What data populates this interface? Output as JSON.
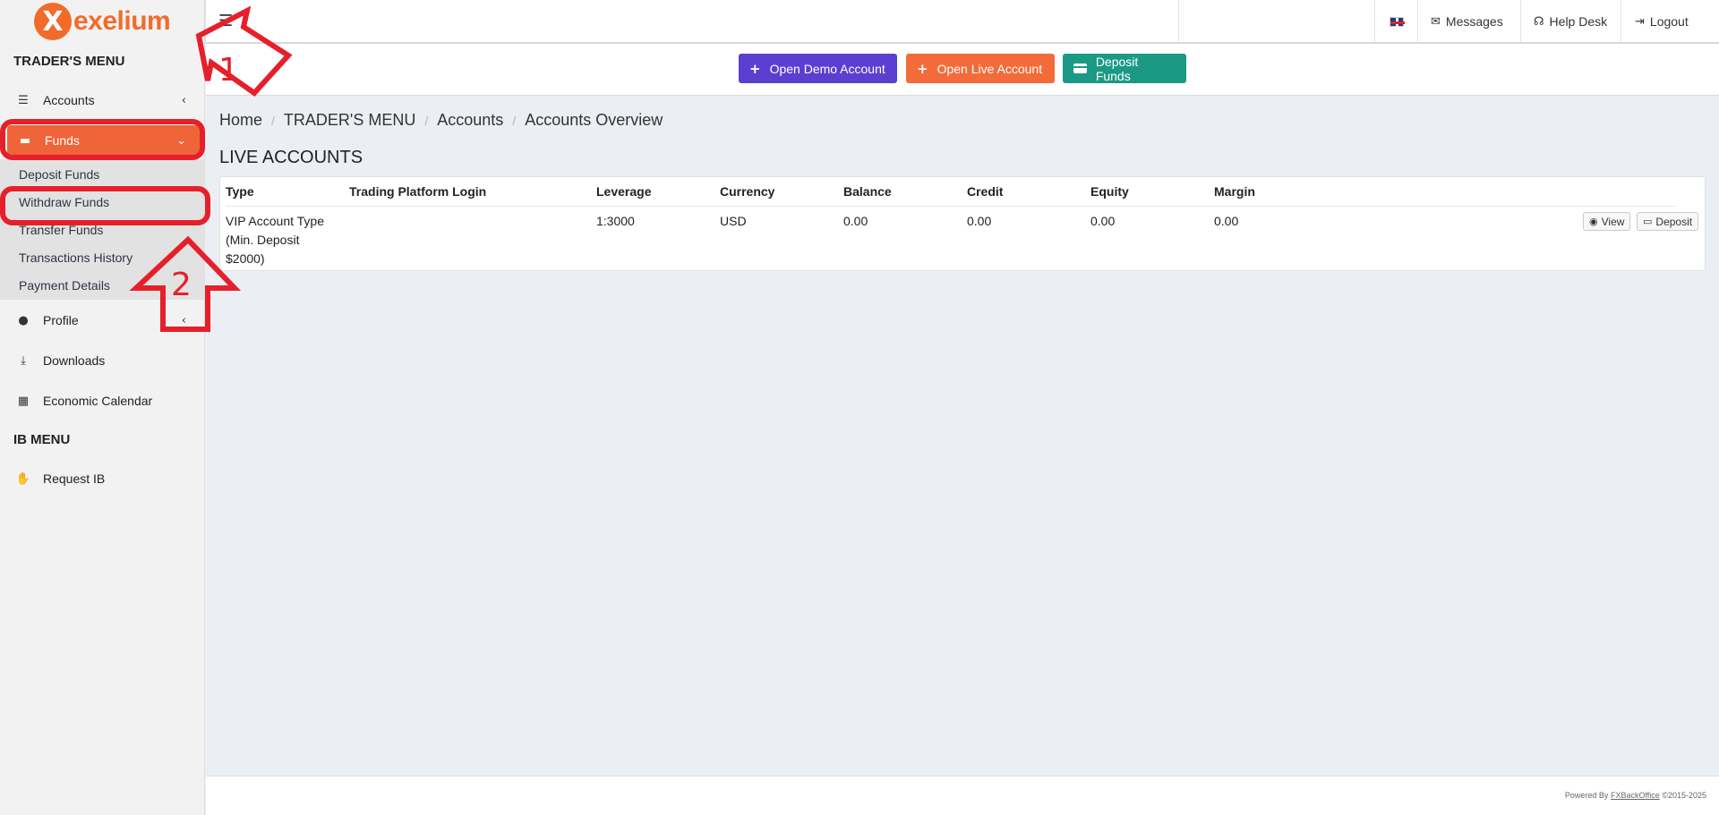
{
  "brand": {
    "logo_mark": "X",
    "logo_text": "exelium",
    "accent": "#f36b2a"
  },
  "sidebar": {
    "traders_heading": "TRADER'S MENU",
    "ib_heading": "IB MENU",
    "items": [
      {
        "label": "Accounts",
        "icon": "list-icon"
      },
      {
        "label": "Funds",
        "icon": "wallet-icon",
        "active": true
      },
      {
        "label": "Profile",
        "icon": "user-icon"
      },
      {
        "label": "Downloads",
        "icon": "download-icon"
      },
      {
        "label": "Economic Calendar",
        "icon": "calendar-icon"
      }
    ],
    "funds_sub": [
      "Deposit Funds",
      "Withdraw Funds",
      "Transfer Funds",
      "Transactions History",
      "Payment Details"
    ],
    "ib_items": [
      {
        "label": "Request IB",
        "icon": "handshake-icon"
      }
    ]
  },
  "annotations": {
    "step1": "1",
    "step2": "2",
    "color": "#e5202a"
  },
  "topbar": {
    "messages": "Messages",
    "help_desk": "Help Desk",
    "logout": "Logout"
  },
  "actions": {
    "open_demo": "Open Demo Account",
    "open_live": "Open Live Account",
    "deposit_funds": "Deposit Funds"
  },
  "breadcrumb": [
    "Home",
    "TRADER'S MENU",
    "Accounts",
    "Accounts Overview"
  ],
  "live_accounts": {
    "title": "LIVE ACCOUNTS",
    "columns": [
      "Type",
      "Trading Platform Login",
      "Leverage",
      "Currency",
      "Balance",
      "Credit",
      "Equity",
      "Margin"
    ],
    "rows": [
      {
        "type_lines": [
          "VIP Account Type",
          "(Min. Deposit",
          "$2000)"
        ],
        "login": "",
        "leverage": "1:3000",
        "currency": "USD",
        "balance": "0.00",
        "credit": "0.00",
        "equity": "0.00",
        "margin": "0.00",
        "view": "View",
        "deposit": "Deposit"
      }
    ]
  },
  "footer": {
    "prefix": "Powered By",
    "link": "FXBackOffice",
    "suffix": "©2015-2025"
  }
}
